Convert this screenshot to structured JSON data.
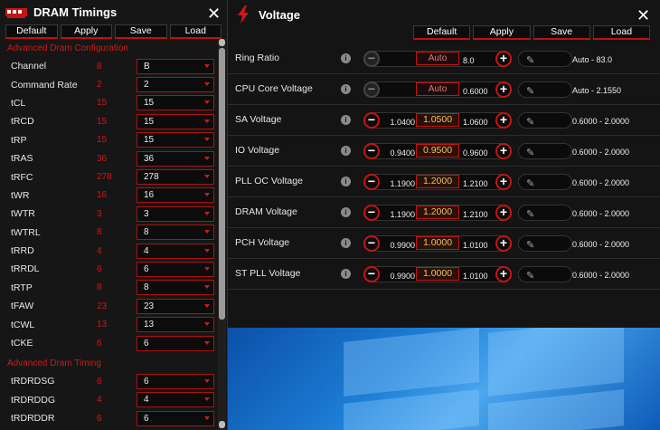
{
  "dram": {
    "title": "DRAM Timings",
    "close": "✕",
    "buttons": [
      "Default",
      "Apply",
      "Save",
      "Load"
    ],
    "section1": "Advanced Dram Configuration",
    "rows": [
      {
        "label": "Channel",
        "current": "8",
        "value": "B"
      },
      {
        "label": "Command Rate",
        "current": "2",
        "value": "2"
      },
      {
        "label": "tCL",
        "current": "15",
        "value": "15"
      },
      {
        "label": "tRCD",
        "current": "15",
        "value": "15"
      },
      {
        "label": "tRP",
        "current": "15",
        "value": "15"
      },
      {
        "label": "tRAS",
        "current": "36",
        "value": "36"
      },
      {
        "label": "tRFC",
        "current": "278",
        "value": "278"
      },
      {
        "label": "tWR",
        "current": "16",
        "value": "16"
      },
      {
        "label": "tWTR",
        "current": "3",
        "value": "3"
      },
      {
        "label": "tWTRL",
        "current": "8",
        "value": "8"
      },
      {
        "label": "tRRD",
        "current": "4",
        "value": "4"
      },
      {
        "label": "tRRDL",
        "current": "6",
        "value": "6"
      },
      {
        "label": "tRTP",
        "current": "8",
        "value": "8"
      },
      {
        "label": "tFAW",
        "current": "23",
        "value": "23"
      },
      {
        "label": "tCWL",
        "current": "13",
        "value": "13"
      },
      {
        "label": "tCKE",
        "current": "6",
        "value": "6"
      }
    ],
    "section2": "Advanced Dram Timing",
    "rows2": [
      {
        "label": "tRDRDSG",
        "current": "6",
        "value": "6"
      },
      {
        "label": "tRDRDDG",
        "current": "4",
        "value": "4"
      },
      {
        "label": "tRDRDDR",
        "current": "6",
        "value": "6"
      }
    ]
  },
  "voltage": {
    "title": "Voltage",
    "close": "✕",
    "buttons": [
      "Default",
      "Apply",
      "Save",
      "Load"
    ],
    "info": "i",
    "rows": [
      {
        "label": "Ring Ratio",
        "min": "",
        "current": "Auto",
        "max": "8.0",
        "range": "Auto - 83.0",
        "auto": true
      },
      {
        "label": "CPU Core Voltage",
        "min": "",
        "current": "Auto",
        "max": "0.6000",
        "range": "Auto - 2.1550",
        "auto": true
      },
      {
        "label": "SA Voltage",
        "min": "1.0400",
        "current": "1.0500",
        "max": "1.0600",
        "range": "0.6000 - 2.0000",
        "auto": false
      },
      {
        "label": "IO Voltage",
        "min": "0.9400",
        "current": "0.9500",
        "max": "0.9600",
        "range": "0.6000 - 2.0000",
        "auto": false
      },
      {
        "label": "PLL OC Voltage",
        "min": "1.1900",
        "current": "1.2000",
        "max": "1.2100",
        "range": "0.6000 - 2.0000",
        "auto": false
      },
      {
        "label": "DRAM Voltage",
        "min": "1.1900",
        "current": "1.2000",
        "max": "1.2100",
        "range": "0.6000 - 2.0000",
        "auto": false
      },
      {
        "label": "PCH Voltage",
        "min": "0.9900",
        "current": "1.0000",
        "max": "1.0100",
        "range": "0.6000 - 2.0000",
        "auto": false
      },
      {
        "label": "ST PLL Voltage",
        "min": "0.9900",
        "current": "1.0000",
        "max": "1.0100",
        "range": "0.6000 - 2.0000",
        "auto": false
      }
    ]
  },
  "colors": {
    "accent": "#c41414",
    "value_gold": "#f0c060"
  }
}
